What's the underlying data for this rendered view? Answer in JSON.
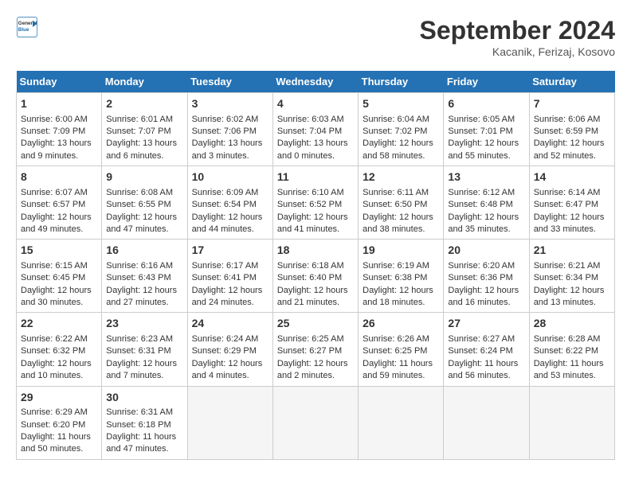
{
  "header": {
    "logo_line1": "General",
    "logo_line2": "Blue",
    "month": "September 2024",
    "location": "Kacanik, Ferizaj, Kosovo"
  },
  "days_of_week": [
    "Sunday",
    "Monday",
    "Tuesday",
    "Wednesday",
    "Thursday",
    "Friday",
    "Saturday"
  ],
  "weeks": [
    [
      {
        "day": "1",
        "lines": [
          "Sunrise: 6:00 AM",
          "Sunset: 7:09 PM",
          "Daylight: 13 hours",
          "and 9 minutes."
        ]
      },
      {
        "day": "2",
        "lines": [
          "Sunrise: 6:01 AM",
          "Sunset: 7:07 PM",
          "Daylight: 13 hours",
          "and 6 minutes."
        ]
      },
      {
        "day": "3",
        "lines": [
          "Sunrise: 6:02 AM",
          "Sunset: 7:06 PM",
          "Daylight: 13 hours",
          "and 3 minutes."
        ]
      },
      {
        "day": "4",
        "lines": [
          "Sunrise: 6:03 AM",
          "Sunset: 7:04 PM",
          "Daylight: 13 hours",
          "and 0 minutes."
        ]
      },
      {
        "day": "5",
        "lines": [
          "Sunrise: 6:04 AM",
          "Sunset: 7:02 PM",
          "Daylight: 12 hours",
          "and 58 minutes."
        ]
      },
      {
        "day": "6",
        "lines": [
          "Sunrise: 6:05 AM",
          "Sunset: 7:01 PM",
          "Daylight: 12 hours",
          "and 55 minutes."
        ]
      },
      {
        "day": "7",
        "lines": [
          "Sunrise: 6:06 AM",
          "Sunset: 6:59 PM",
          "Daylight: 12 hours",
          "and 52 minutes."
        ]
      }
    ],
    [
      {
        "day": "8",
        "lines": [
          "Sunrise: 6:07 AM",
          "Sunset: 6:57 PM",
          "Daylight: 12 hours",
          "and 49 minutes."
        ]
      },
      {
        "day": "9",
        "lines": [
          "Sunrise: 6:08 AM",
          "Sunset: 6:55 PM",
          "Daylight: 12 hours",
          "and 47 minutes."
        ]
      },
      {
        "day": "10",
        "lines": [
          "Sunrise: 6:09 AM",
          "Sunset: 6:54 PM",
          "Daylight: 12 hours",
          "and 44 minutes."
        ]
      },
      {
        "day": "11",
        "lines": [
          "Sunrise: 6:10 AM",
          "Sunset: 6:52 PM",
          "Daylight: 12 hours",
          "and 41 minutes."
        ]
      },
      {
        "day": "12",
        "lines": [
          "Sunrise: 6:11 AM",
          "Sunset: 6:50 PM",
          "Daylight: 12 hours",
          "and 38 minutes."
        ]
      },
      {
        "day": "13",
        "lines": [
          "Sunrise: 6:12 AM",
          "Sunset: 6:48 PM",
          "Daylight: 12 hours",
          "and 35 minutes."
        ]
      },
      {
        "day": "14",
        "lines": [
          "Sunrise: 6:14 AM",
          "Sunset: 6:47 PM",
          "Daylight: 12 hours",
          "and 33 minutes."
        ]
      }
    ],
    [
      {
        "day": "15",
        "lines": [
          "Sunrise: 6:15 AM",
          "Sunset: 6:45 PM",
          "Daylight: 12 hours",
          "and 30 minutes."
        ]
      },
      {
        "day": "16",
        "lines": [
          "Sunrise: 6:16 AM",
          "Sunset: 6:43 PM",
          "Daylight: 12 hours",
          "and 27 minutes."
        ]
      },
      {
        "day": "17",
        "lines": [
          "Sunrise: 6:17 AM",
          "Sunset: 6:41 PM",
          "Daylight: 12 hours",
          "and 24 minutes."
        ]
      },
      {
        "day": "18",
        "lines": [
          "Sunrise: 6:18 AM",
          "Sunset: 6:40 PM",
          "Daylight: 12 hours",
          "and 21 minutes."
        ]
      },
      {
        "day": "19",
        "lines": [
          "Sunrise: 6:19 AM",
          "Sunset: 6:38 PM",
          "Daylight: 12 hours",
          "and 18 minutes."
        ]
      },
      {
        "day": "20",
        "lines": [
          "Sunrise: 6:20 AM",
          "Sunset: 6:36 PM",
          "Daylight: 12 hours",
          "and 16 minutes."
        ]
      },
      {
        "day": "21",
        "lines": [
          "Sunrise: 6:21 AM",
          "Sunset: 6:34 PM",
          "Daylight: 12 hours",
          "and 13 minutes."
        ]
      }
    ],
    [
      {
        "day": "22",
        "lines": [
          "Sunrise: 6:22 AM",
          "Sunset: 6:32 PM",
          "Daylight: 12 hours",
          "and 10 minutes."
        ]
      },
      {
        "day": "23",
        "lines": [
          "Sunrise: 6:23 AM",
          "Sunset: 6:31 PM",
          "Daylight: 12 hours",
          "and 7 minutes."
        ]
      },
      {
        "day": "24",
        "lines": [
          "Sunrise: 6:24 AM",
          "Sunset: 6:29 PM",
          "Daylight: 12 hours",
          "and 4 minutes."
        ]
      },
      {
        "day": "25",
        "lines": [
          "Sunrise: 6:25 AM",
          "Sunset: 6:27 PM",
          "Daylight: 12 hours",
          "and 2 minutes."
        ]
      },
      {
        "day": "26",
        "lines": [
          "Sunrise: 6:26 AM",
          "Sunset: 6:25 PM",
          "Daylight: 11 hours",
          "and 59 minutes."
        ]
      },
      {
        "day": "27",
        "lines": [
          "Sunrise: 6:27 AM",
          "Sunset: 6:24 PM",
          "Daylight: 11 hours",
          "and 56 minutes."
        ]
      },
      {
        "day": "28",
        "lines": [
          "Sunrise: 6:28 AM",
          "Sunset: 6:22 PM",
          "Daylight: 11 hours",
          "and 53 minutes."
        ]
      }
    ],
    [
      {
        "day": "29",
        "lines": [
          "Sunrise: 6:29 AM",
          "Sunset: 6:20 PM",
          "Daylight: 11 hours",
          "and 50 minutes."
        ]
      },
      {
        "day": "30",
        "lines": [
          "Sunrise: 6:31 AM",
          "Sunset: 6:18 PM",
          "Daylight: 11 hours",
          "and 47 minutes."
        ]
      },
      null,
      null,
      null,
      null,
      null
    ]
  ]
}
